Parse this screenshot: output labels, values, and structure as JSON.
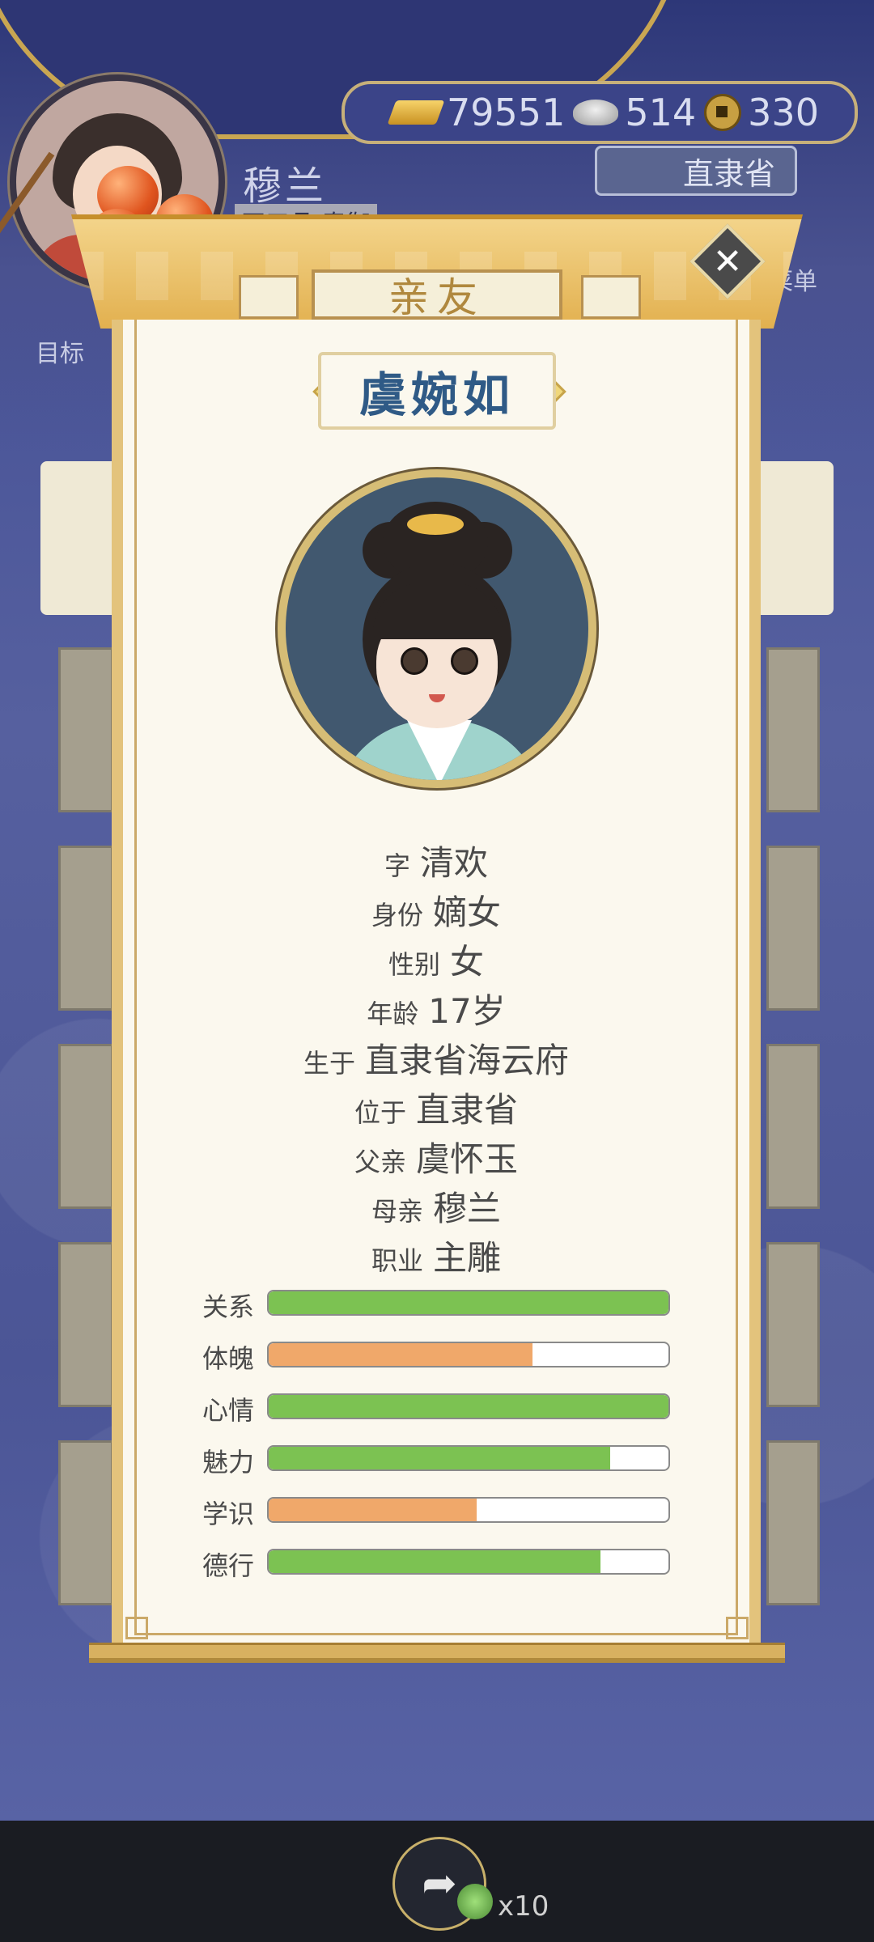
{
  "hud": {
    "player_name": "穆兰",
    "player_rank": "正五品·奉御",
    "currency": {
      "gold": "79551",
      "silver": "514",
      "coin": "330"
    },
    "province": "直隶省",
    "left_label": "目标",
    "menu_label": "菜单"
  },
  "panel": {
    "tab_title": "亲友",
    "person_name": "虞婉如",
    "info": [
      {
        "label": "字",
        "value": "清欢"
      },
      {
        "label": "身份",
        "value": "嫡女"
      },
      {
        "label": "性别",
        "value": "女"
      },
      {
        "label": "年龄",
        "value": "17岁"
      },
      {
        "label": "生于",
        "value": "直隶省海云府"
      },
      {
        "label": "位于",
        "value": "直隶省"
      },
      {
        "label": "父亲",
        "value": "虞怀玉"
      },
      {
        "label": "母亲",
        "value": "穆兰"
      },
      {
        "label": "职业",
        "value": "主雕"
      }
    ],
    "stats": [
      {
        "label": "关系",
        "fraction": 1.0,
        "color": "#7cc252"
      },
      {
        "label": "体魄",
        "fraction": 0.66,
        "color": "#f0a86a"
      },
      {
        "label": "心情",
        "fraction": 1.0,
        "color": "#7cc252"
      },
      {
        "label": "魅力",
        "fraction": 0.855,
        "color": "#7cc252"
      },
      {
        "label": "学识",
        "fraction": 0.52,
        "color": "#f0a86a"
      },
      {
        "label": "德行",
        "fraction": 0.83,
        "color": "#7cc252"
      }
    ]
  },
  "bottom": {
    "reward_count": "x10"
  }
}
